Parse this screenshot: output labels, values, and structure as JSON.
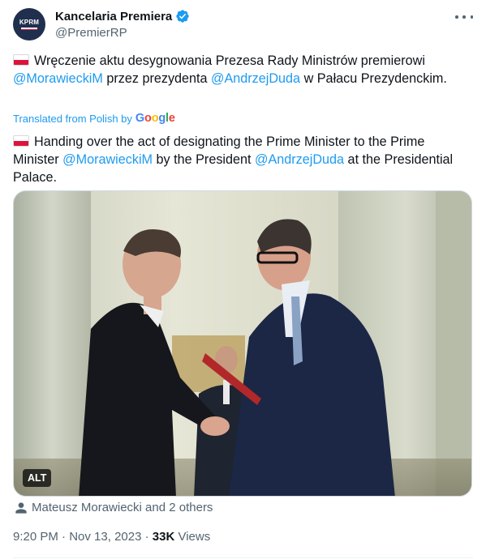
{
  "colors": {
    "link": "#1d9bf0",
    "secondary": "#536471",
    "text": "#0f1419",
    "verified": "#1d9bf0",
    "flag_white": "#ffffff",
    "flag_red": "#dc143c"
  },
  "header": {
    "avatar_text": "KPRM",
    "display_name": "Kancelaria Premiera",
    "handle": "@PremierRP",
    "verified_icon": "verified-badge-icon",
    "more_icon": "more-dots-icon"
  },
  "tweet_pl": {
    "flag_icon": "poland-flag-icon",
    "part1": "Wręczenie aktu desygnowania Prezesa Rady Ministrów premierowi ",
    "mention1": "@MorawieckiM",
    "part2": " przez prezydenta ",
    "mention2": "@AndrzejDuda",
    "part3": " w Pałacu Prezydenckim."
  },
  "translation": {
    "label": "Translated from Polish by",
    "brand": [
      "G",
      "o",
      "o",
      "g",
      "l",
      "e"
    ]
  },
  "tweet_en": {
    "flag_icon": "poland-flag-icon",
    "part1": "Handing over the act of designating the Prime Minister to the Prime Minister ",
    "mention1": "@MorawieckiM",
    "part2": " by the President ",
    "mention2": "@AndrzejDuda",
    "part3": " at the Presidential Palace."
  },
  "media": {
    "alt_label": "ALT"
  },
  "tagged": {
    "icon": "person-icon",
    "text": "Mateusz Morawiecki and 2 others"
  },
  "meta": {
    "time": "9:20 PM",
    "sep1": " · ",
    "date": "Nov 13, 2023",
    "sep2": " · ",
    "views_count": "33K",
    "views_label": " Views"
  }
}
